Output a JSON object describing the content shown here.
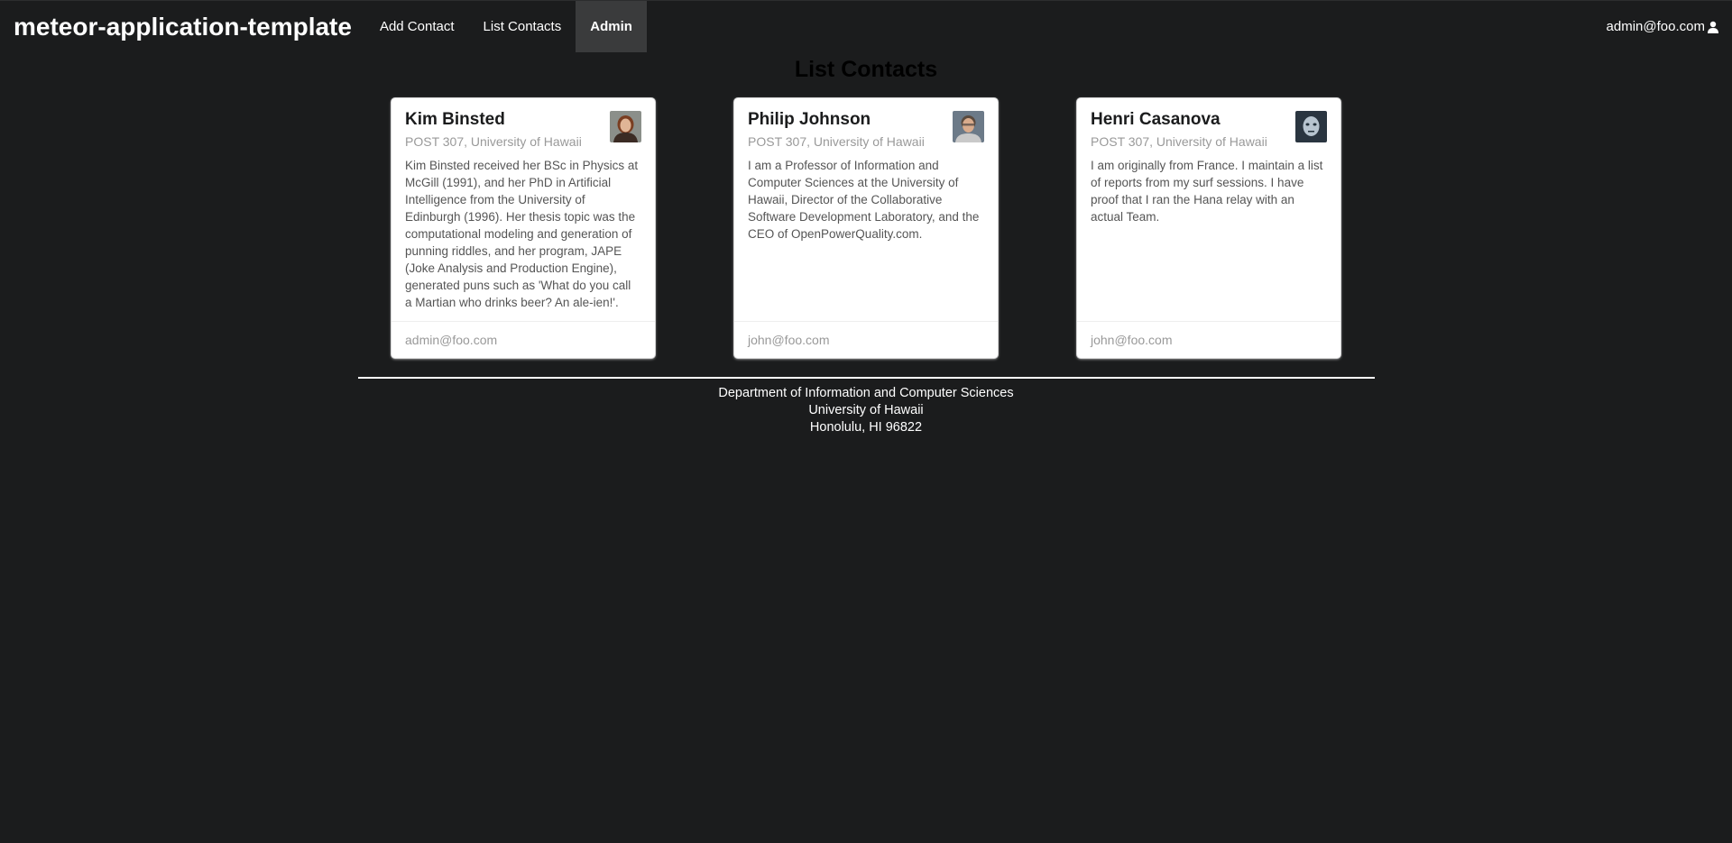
{
  "navbar": {
    "brand": "meteor-application-template",
    "items": [
      {
        "label": "Add Contact"
      },
      {
        "label": "List Contacts"
      },
      {
        "label": "Admin"
      }
    ],
    "user": "admin@foo.com",
    "user_icon": "user-icon"
  },
  "page_title": "List Contacts",
  "contacts": [
    {
      "name": "Kim Binsted",
      "address": "POST 307, University of Hawaii",
      "description": "Kim Binsted received her BSc in Physics at McGill (1991), and her PhD in Artificial Intelligence from the University of Edinburgh (1996). Her thesis topic was the computational modeling and generation of punning riddles, and her program, JAPE (Joke Analysis and Production Engine), generated puns such as 'What do you call a Martian who drinks beer? An ale-ien!'.",
      "owner": "admin@foo.com"
    },
    {
      "name": "Philip Johnson",
      "address": "POST 307, University of Hawaii",
      "description": "I am a Professor of Information and Computer Sciences at the University of Hawaii, Director of the Collaborative Software Development Laboratory, and the CEO of OpenPowerQuality.com.",
      "owner": "john@foo.com"
    },
    {
      "name": "Henri Casanova",
      "address": "POST 307, University of Hawaii",
      "description": "I am originally from France. I maintain a list of reports from my surf sessions. I have proof that I ran the Hana relay with an actual Team.",
      "owner": "john@foo.com"
    }
  ],
  "footer": {
    "line1": "Department of Information and Computer Sciences",
    "line2": "University of Hawaii",
    "line3": "Honolulu, HI 96822"
  },
  "colors": {
    "background": "#1b1c1d",
    "active_nav": "#3a3b3c",
    "card": "#ffffff",
    "meta_text": "#999999"
  }
}
